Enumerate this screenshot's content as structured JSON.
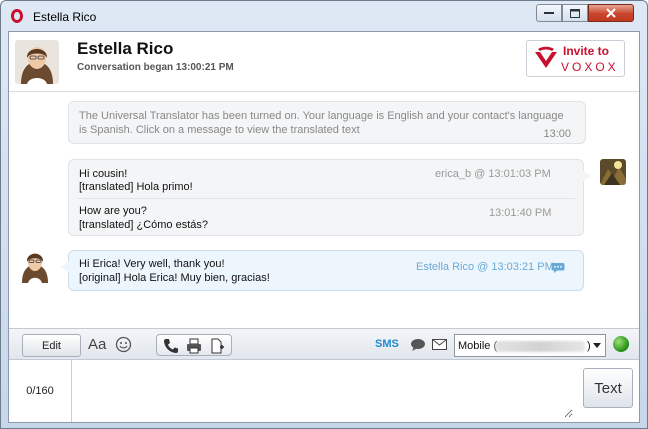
{
  "window": {
    "title": "Estella Rico"
  },
  "header": {
    "contact_name": "Estella Rico",
    "conversation_began": "Conversation began 13:00:21 PM",
    "invite_line1": "Invite to",
    "invite_line2": "VOXOX"
  },
  "conversation": {
    "system_message": {
      "text_line1": "The Universal Translator has been turned on. Your language is English and your contact's language",
      "text_line2": "is Spanish. Click on a message to view the translated text",
      "time": "13:00"
    },
    "remote_message": {
      "meta1": "erica_b @ 13:01:03 PM",
      "line1": "Hi cousin!",
      "line2": "[translated] Hola primo!",
      "meta2": "13:01:40 PM",
      "line3": "How are you?",
      "line4": "[translated] ¿Cómo estás?"
    },
    "self_message": {
      "meta": "Estella Rico @ 13:03:21 PM",
      "line1": "Hi Erica! Very well, thank you!",
      "line2": "[original] Hola Erica! Muy bien, gracias!"
    }
  },
  "toolbar": {
    "edit_label": "Edit",
    "font_label": "Aa",
    "sms_label": "SMS",
    "mobile_select_value": "Mobile (",
    "mobile_select_close": ")"
  },
  "input": {
    "char_count": "0/160",
    "placeholder": "",
    "send_label": "Text"
  },
  "colors": {
    "accent_red": "#c8102e",
    "sms_blue": "#1e8bd0",
    "self_bubble": "#eef6fd"
  }
}
